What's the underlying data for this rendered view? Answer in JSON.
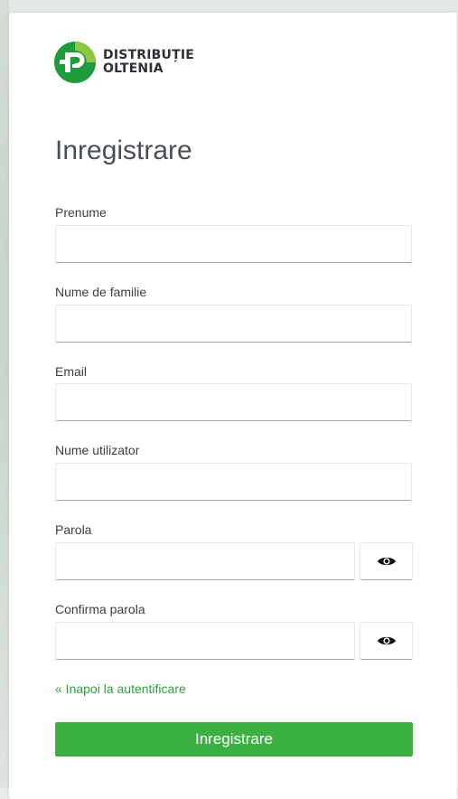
{
  "brand": {
    "name_line1": "DISTRIBUȚIE",
    "name_line2": "OLTENIA",
    "logo_icon": "distributie-oltenia-logo",
    "accent_color": "#3cb043",
    "logo_color_dark": "#1f9a3c",
    "logo_color_light": "#8dc63f"
  },
  "form": {
    "title": "Inregistrare",
    "fields": {
      "first_name": {
        "label": "Prenume",
        "value": "",
        "placeholder": ""
      },
      "last_name": {
        "label": "Nume de familie",
        "value": "",
        "placeholder": ""
      },
      "email": {
        "label": "Email",
        "value": "",
        "placeholder": ""
      },
      "username": {
        "label": "Nume utilizator",
        "value": "",
        "placeholder": ""
      },
      "password": {
        "label": "Parola",
        "value": "",
        "placeholder": "",
        "toggle_icon": "eye-icon"
      },
      "confirm_password": {
        "label": "Confirma parola",
        "value": "",
        "placeholder": "",
        "toggle_icon": "eye-icon"
      }
    },
    "back_link": "« Inapoi la autentificare",
    "submit_label": "Inregistrare"
  }
}
